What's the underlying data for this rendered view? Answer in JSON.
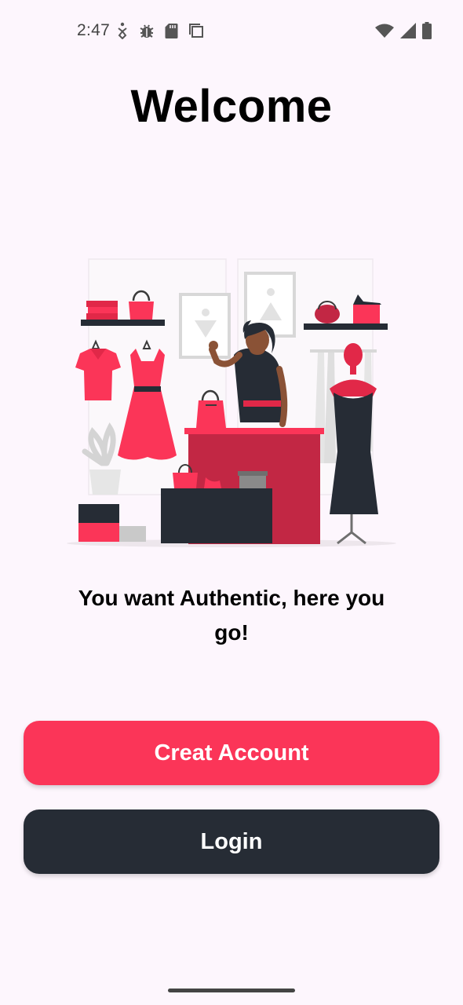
{
  "status_bar": {
    "time": "2:47",
    "left_icons": [
      "accessibility-icon",
      "bug-icon",
      "sd-card-icon",
      "copy-icon"
    ],
    "right_icons": [
      "wifi-icon",
      "cellular-signal-icon",
      "battery-icon"
    ]
  },
  "welcome": {
    "title": "Welcome",
    "tagline": "You want Authentic, here you go!",
    "illustration": "shop-clerk-boutique-illustration"
  },
  "buttons": {
    "create_account": "Creat Account",
    "login": "Login"
  },
  "colors": {
    "background": "#fdf6fd",
    "accent": "#fb3558",
    "dark": "#262c35"
  }
}
